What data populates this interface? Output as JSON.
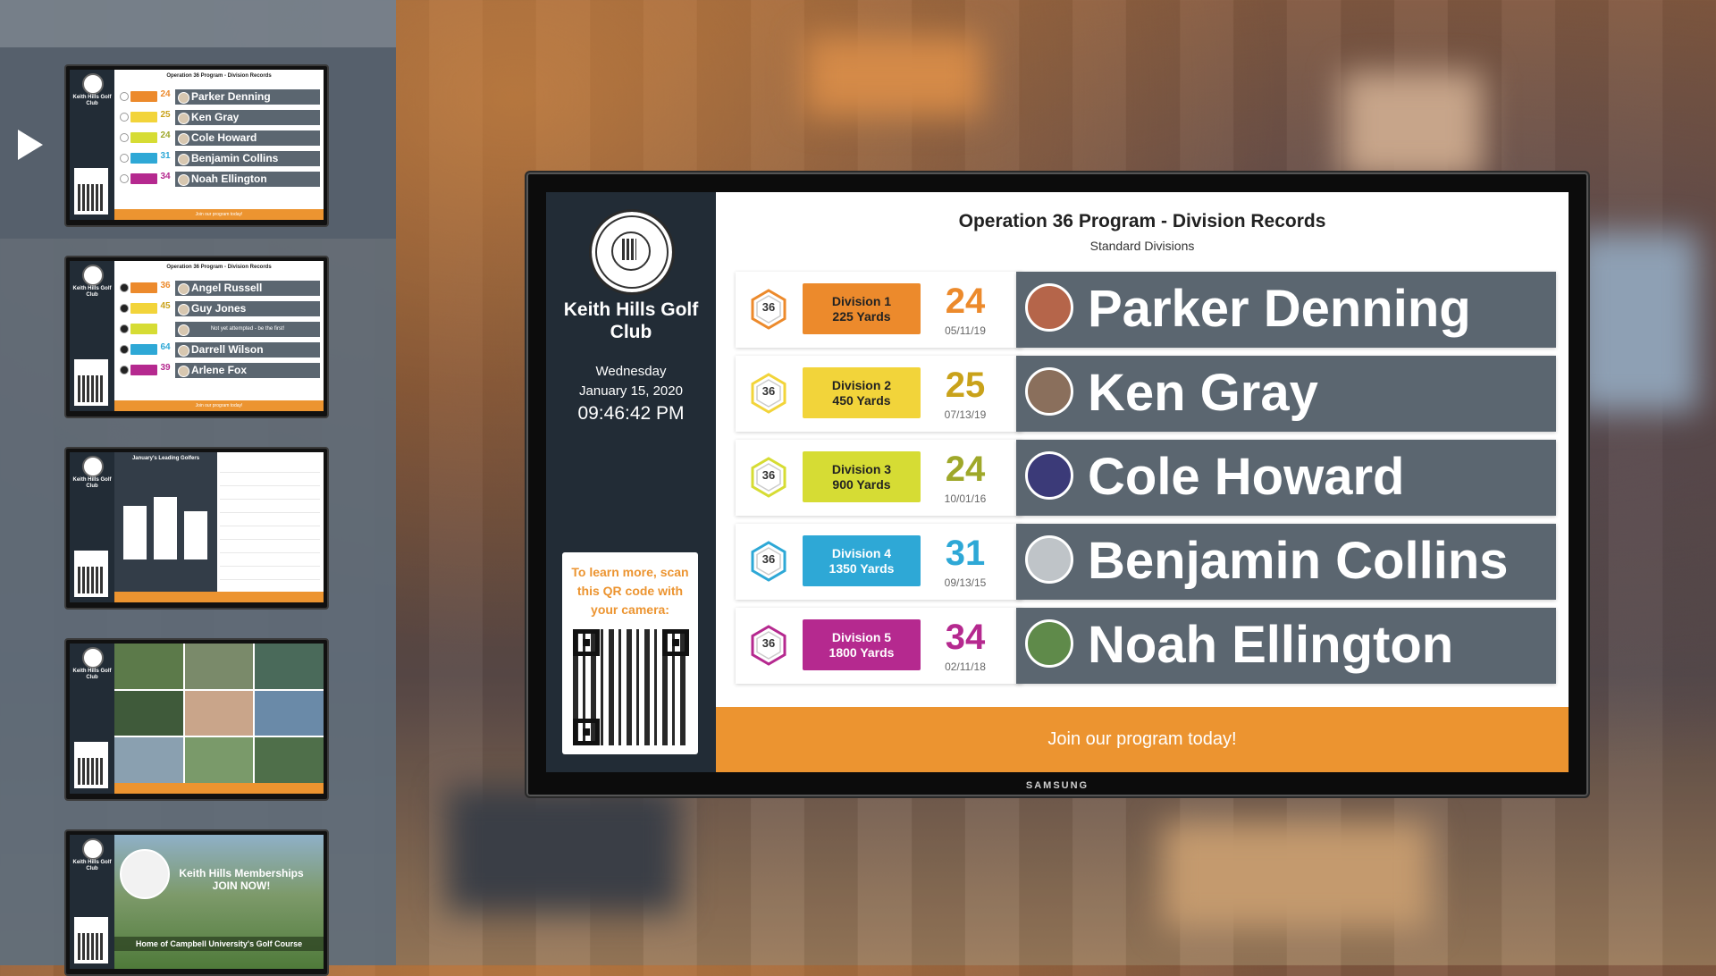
{
  "sidebar": {
    "thumbnails": [
      {
        "club": "Keith Hills Golf Club",
        "title": "Operation 36 Program - Division Records",
        "rows": [
          {
            "score": "24",
            "name": "Parker Denning",
            "color": "#ec8a2c"
          },
          {
            "score": "25",
            "name": "Ken Gray",
            "color": "#f2d43a"
          },
          {
            "score": "24",
            "name": "Cole Howard",
            "color": "#d6dc34"
          },
          {
            "score": "31",
            "name": "Benjamin Collins",
            "color": "#2ea8d6"
          },
          {
            "score": "34",
            "name": "Noah Ellington",
            "color": "#b5298f"
          }
        ],
        "footer": "Join our program today!"
      },
      {
        "club": "Keith Hills Golf Club",
        "title": "Operation 36 Program - Division Records",
        "rows": [
          {
            "score": "36",
            "name": "Angel Russell",
            "color": "#ec8a2c"
          },
          {
            "score": "45",
            "name": "Guy Jones",
            "color": "#f2d43a"
          },
          {
            "score": "",
            "name": "Not yet attempted - be the first!",
            "color": "#d6dc34"
          },
          {
            "score": "64",
            "name": "Darrell Wilson",
            "color": "#2ea8d6"
          },
          {
            "score": "39",
            "name": "Arlene Fox",
            "color": "#b5298f"
          }
        ],
        "footer": "Join our program today!"
      },
      {
        "club": "Keith Hills Golf Club",
        "title": "January's Leading Golfers"
      },
      {
        "club": "Keith Hills Golf Club"
      },
      {
        "club": "Keith Hills Golf Club",
        "headline": "Keith Hills Memberships JOIN NOW!",
        "caption": "Home of Campbell University's Golf Course"
      }
    ]
  },
  "display": {
    "brand": "SAMSUNG",
    "club_name": "Keith Hills Golf Club",
    "day": "Wednesday",
    "date": "January 15, 2020",
    "time": "09:46:42 PM",
    "qr_prompt": "To learn more, scan this QR code with your camera:",
    "title": "Operation 36 Program - Division Records",
    "subtitle": "Standard Divisions",
    "badge_label": "36",
    "records": [
      {
        "division": "Division 1",
        "yards": "225 Yards",
        "score": "24",
        "date": "05/11/19",
        "name": "Parker Denning",
        "color": "#ec8a2c",
        "score_color": "#ec8a2c",
        "avatar_color": "#b5654a"
      },
      {
        "division": "Division 2",
        "yards": "450 Yards",
        "score": "25",
        "date": "07/13/19",
        "name": "Ken Gray",
        "color": "#f2d43a",
        "score_color": "#c9a21a",
        "avatar_color": "#8a6f5c"
      },
      {
        "division": "Division 3",
        "yards": "900 Yards",
        "score": "24",
        "date": "10/01/16",
        "name": "Cole Howard",
        "color": "#d6dc34",
        "score_color": "#9fa82a",
        "avatar_color": "#3b3a78"
      },
      {
        "division": "Division 4",
        "yards": "1350 Yards",
        "score": "31",
        "date": "09/13/15",
        "name": "Benjamin Collins",
        "color": "#2ea8d6",
        "score_color": "#2ea8d6",
        "avatar_color": "#bfc4c8"
      },
      {
        "division": "Division 5",
        "yards": "1800 Yards",
        "score": "34",
        "date": "02/11/18",
        "name": "Noah Ellington",
        "color": "#b5298f",
        "score_color": "#b5298f",
        "avatar_color": "#5f8a4a"
      }
    ],
    "footer": "Join our program today!"
  }
}
